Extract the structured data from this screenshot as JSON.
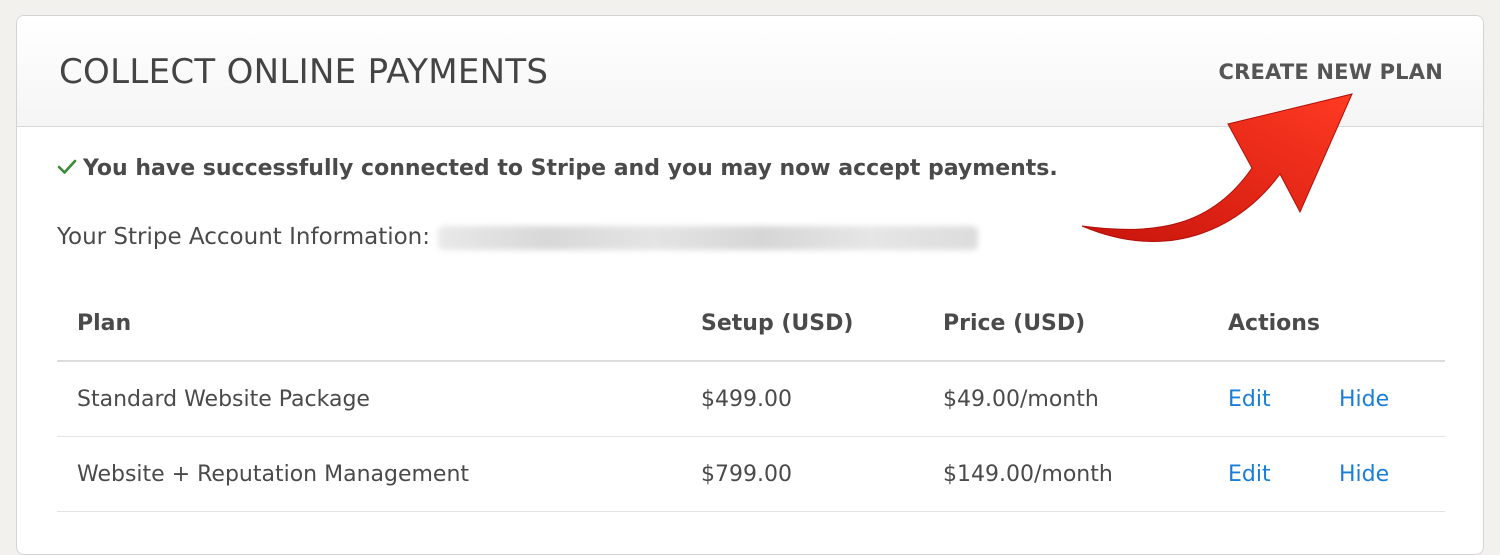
{
  "header": {
    "title": "COLLECT ONLINE PAYMENTS",
    "create_label": "CREATE NEW PLAN"
  },
  "status": {
    "message": "You have successfully connected to Stripe and you may now accept payments.",
    "icon": "check-icon",
    "icon_color": "#3a8a3a"
  },
  "account": {
    "label": "Your Stripe Account Information:"
  },
  "table": {
    "columns": [
      "Plan",
      "Setup (USD)",
      "Price (USD)",
      "Actions"
    ],
    "rows": [
      {
        "plan": "Standard Website Package",
        "setup": "$499.00",
        "price": "$49.00/month",
        "edit": "Edit",
        "hide": "Hide"
      },
      {
        "plan": "Website + Reputation Management",
        "setup": "$799.00",
        "price": "$149.00/month",
        "edit": "Edit",
        "hide": "Hide"
      }
    ]
  },
  "colors": {
    "link": "#1a7ed6",
    "arrow": "#e8261c"
  }
}
